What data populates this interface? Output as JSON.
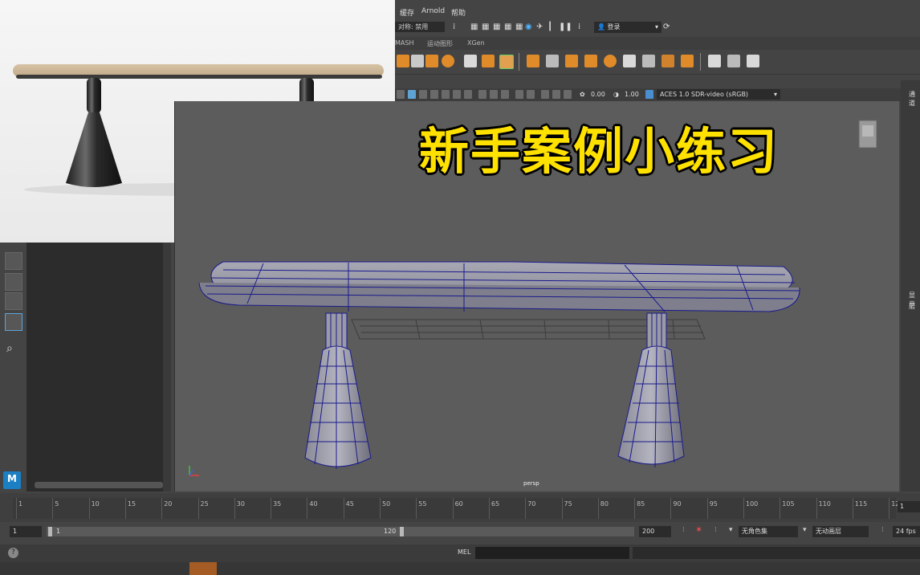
{
  "menubar": {
    "items": [
      "缓存",
      "Arnold",
      "帮助"
    ]
  },
  "statusline": {
    "field_value": "对称: 禁用",
    "login_label": "登录"
  },
  "shelf_tabs": [
    "MASH",
    "运动图形",
    "XGen"
  ],
  "viewport_toolbar": {
    "exposure": "0.00",
    "gamma": "1.00",
    "color_space": "ACES 1.0 SDR-video (sRGB)"
  },
  "overlay_title": "新手案例小练习",
  "viewport": {
    "camera_label": "persp"
  },
  "right_panel": {
    "label_channel": "通道",
    "label_display": "显示",
    "label_layer": "层"
  },
  "timeline": {
    "tick_labels": [
      "1",
      "5",
      "10",
      "15",
      "20",
      "25",
      "30",
      "35",
      "40",
      "45",
      "50",
      "55",
      "60",
      "65",
      "70",
      "75",
      "80",
      "85",
      "90",
      "95",
      "100",
      "105",
      "110",
      "115",
      "12"
    ],
    "current_frame": "1"
  },
  "range": {
    "start": "1",
    "inner_start": "1",
    "inner_end": "120",
    "end": "200",
    "character_set": "无角色集",
    "anim_layer": "无动画层",
    "fps": "24 fps"
  },
  "command_line": {
    "mode_label": "MEL"
  },
  "logo": {
    "letter": "M"
  },
  "colors": {
    "title_yellow": "#ffe100",
    "shelf_orange": "#e08b2a",
    "wire_blue": "#1a1a8c"
  }
}
